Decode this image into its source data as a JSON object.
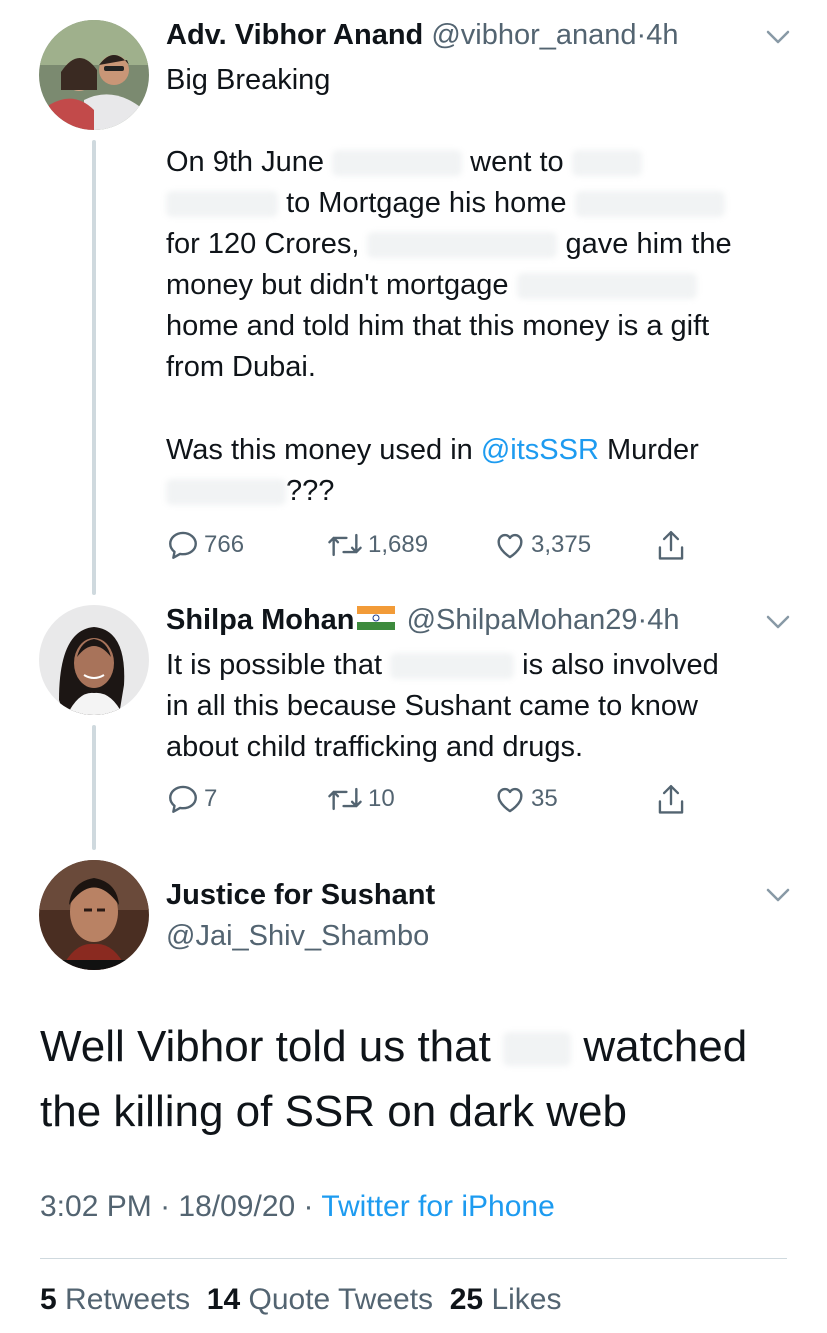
{
  "tweet1": {
    "name": "Adv. Vibhor Anand",
    "handle": "@vibhor_anand",
    "dot": "·",
    "time": "4h",
    "line1": "Big Breaking",
    "line3a": "On 9th June",
    "line3b": "went to",
    "line4": "to Mortgage his home",
    "line5a": "for 120 Crores,",
    "line5b": "gave him the",
    "line6": "money but didn't mortgage",
    "line7": "home and told him that this money is a gift",
    "line8": "from Dubai.",
    "line10a": "Was this money used in",
    "line10mention": "@itsSSR",
    "line10b": "Murder",
    "line11": "???",
    "replies": "766",
    "retweets": "1,689",
    "likes": "3,375"
  },
  "tweet2": {
    "name": "Shilpa Mohan",
    "handle": "@ShilpaMohan29",
    "dot": "·",
    "time": "4h",
    "line1a": "It is possible that",
    "line1b": "is also involved",
    "line2": "in all this because Sushant came to know",
    "line3": "about child trafficking and drugs.",
    "replies": "7",
    "retweets": "10",
    "likes": "35"
  },
  "main": {
    "name": "Justice for Sushant",
    "handle": "@Jai_Shiv_Shambo",
    "text1a": "Well Vibhor told us that",
    "text1b": "watched",
    "text2": "the killing of SSR on dark web",
    "time": "3:02 PM",
    "dot1": "·",
    "date": "18/09/20",
    "dot2": "·",
    "source": "Twitter for iPhone"
  },
  "stats": {
    "retweets_count": "5",
    "retweets_label": "Retweets",
    "quotes_count": "14",
    "quotes_label": "Quote Tweets",
    "likes_count": "25",
    "likes_label": "Likes"
  },
  "colors": {
    "link": "#1d9bf0",
    "muted": "#536471",
    "thread_line": "#cfd9de"
  },
  "icons": [
    "reply-icon",
    "retweet-icon",
    "like-icon",
    "share-icon",
    "chevron-down-icon",
    "india-flag-icon"
  ]
}
